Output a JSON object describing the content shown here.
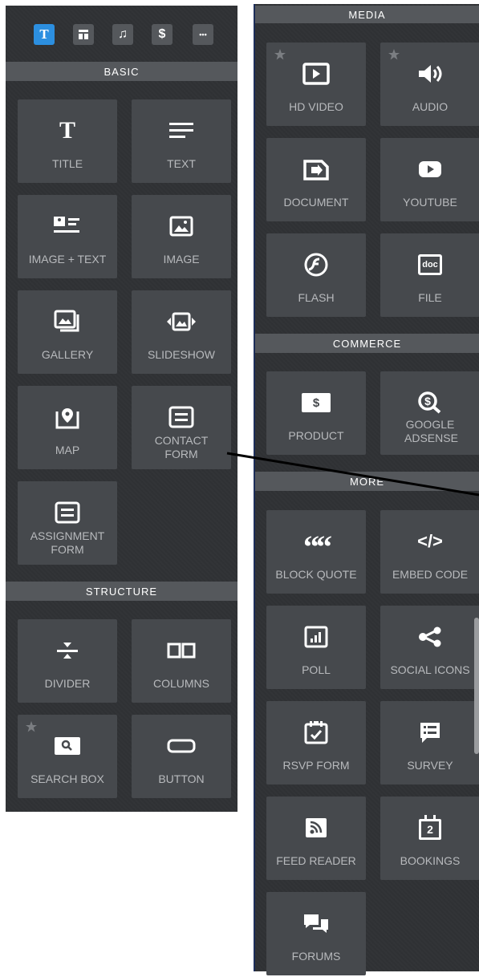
{
  "tabs": [
    {
      "icon": "text-tab-icon",
      "glyph": "T",
      "active": true
    },
    {
      "icon": "layout-tab-icon",
      "glyph": "",
      "active": false
    },
    {
      "icon": "music-tab-icon",
      "glyph": "♫",
      "active": false
    },
    {
      "icon": "dollar-tab-icon",
      "glyph": "$",
      "active": false
    },
    {
      "icon": "more-tab-icon",
      "glyph": "•••",
      "active": false
    }
  ],
  "sections": {
    "basic": "BASIC",
    "structure": "STRUCTURE",
    "media": "MEDIA",
    "commerce": "COMMERCE",
    "more": "MORE"
  },
  "basic": [
    {
      "label": "TITLE",
      "icon": "title-icon"
    },
    {
      "label": "TEXT",
      "icon": "text-lines-icon"
    },
    {
      "label": "IMAGE + TEXT",
      "icon": "image-text-icon"
    },
    {
      "label": "IMAGE",
      "icon": "image-icon"
    },
    {
      "label": "GALLERY",
      "icon": "gallery-icon"
    },
    {
      "label": "SLIDESHOW",
      "icon": "slideshow-icon"
    },
    {
      "label": "MAP",
      "icon": "map-pin-icon"
    },
    {
      "label": "CONTACT FORM",
      "icon": "form-icon"
    },
    {
      "label": "ASSIGNMENT FORM",
      "icon": "form-icon"
    }
  ],
  "structure": [
    {
      "label": "DIVIDER",
      "icon": "divider-icon"
    },
    {
      "label": "COLUMNS",
      "icon": "columns-icon"
    },
    {
      "label": "SEARCH BOX",
      "icon": "search-icon",
      "starred": true
    },
    {
      "label": "BUTTON",
      "icon": "button-icon"
    }
  ],
  "media": [
    {
      "label": "HD VIDEO",
      "icon": "play-icon",
      "starred": true
    },
    {
      "label": "AUDIO",
      "icon": "speaker-icon",
      "starred": true
    },
    {
      "label": "DOCUMENT",
      "icon": "document-icon"
    },
    {
      "label": "YOUTUBE",
      "icon": "youtube-icon"
    },
    {
      "label": "FLASH",
      "icon": "flash-icon"
    },
    {
      "label": "FILE",
      "icon": "file-doc-icon",
      "badge": "doc"
    }
  ],
  "commerce": [
    {
      "label": "PRODUCT",
      "icon": "product-icon",
      "badge": "$"
    },
    {
      "label": "GOOGLE ADSENSE",
      "icon": "adsense-icon"
    }
  ],
  "more": [
    {
      "label": "BLOCK QUOTE",
      "icon": "quote-icon",
      "badge": "““"
    },
    {
      "label": "EMBED CODE",
      "icon": "code-icon",
      "badge": "</>"
    },
    {
      "label": "POLL",
      "icon": "poll-icon"
    },
    {
      "label": "SOCIAL ICONS",
      "icon": "share-icon"
    },
    {
      "label": "RSVP FORM",
      "icon": "rsvp-calendar-icon"
    },
    {
      "label": "SURVEY",
      "icon": "survey-icon"
    },
    {
      "label": "FEED READER",
      "icon": "rss-icon"
    },
    {
      "label": "BOOKINGS",
      "icon": "bookings-calendar-icon",
      "badge": "2"
    },
    {
      "label": "FORUMS",
      "icon": "forums-icon"
    }
  ],
  "colors": {
    "panel": "#2f3134",
    "tile": "#46494d",
    "header": "#55585c",
    "accent": "#2c8fe0",
    "icon": "#ffffff",
    "label": "#b8babd"
  }
}
